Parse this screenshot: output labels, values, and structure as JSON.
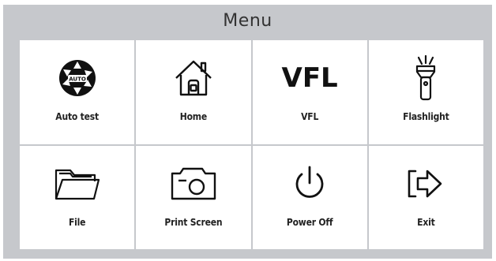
{
  "menu": {
    "title": "Menu",
    "items": [
      {
        "label": "Auto test",
        "icon": "aperture-auto-icon",
        "badge": "AUTO"
      },
      {
        "label": "Home",
        "icon": "home-icon"
      },
      {
        "label": "VFL",
        "icon": "vfl-text-icon",
        "icon_text": "VFL"
      },
      {
        "label": "Flashlight",
        "icon": "flashlight-icon"
      },
      {
        "label": "File",
        "icon": "folder-icon"
      },
      {
        "label": "Print Screen",
        "icon": "camera-icon"
      },
      {
        "label": "Power Off",
        "icon": "power-icon"
      },
      {
        "label": "Exit",
        "icon": "exit-arrow-icon"
      }
    ]
  },
  "colors": {
    "frame": "#c6c8cc",
    "tile": "#ffffff",
    "ink": "#111111"
  }
}
